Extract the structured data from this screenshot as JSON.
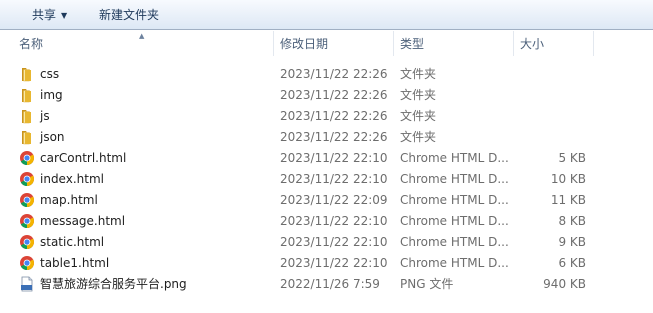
{
  "toolbar": {
    "share_label": "共享",
    "share_arrow": "▼",
    "newfolder_label": "新建文件夹"
  },
  "columns": {
    "name": "名称",
    "date": "修改日期",
    "type": "类型",
    "size": "大小",
    "sort_indicator": "▲"
  },
  "colors": {
    "folder": "#e8b730",
    "chrome_red": "#db4437",
    "chrome_green": "#0f9d58",
    "chrome_yellow": "#f4b400",
    "chrome_blue": "#4285f4",
    "png_blue": "#3b6fb6"
  },
  "files": [
    {
      "name": "css",
      "date": "2023/11/22 22:26",
      "type": "文件夹",
      "size": "",
      "icon": "folder-icon"
    },
    {
      "name": "img",
      "date": "2023/11/22 22:26",
      "type": "文件夹",
      "size": "",
      "icon": "folder-icon"
    },
    {
      "name": "js",
      "date": "2023/11/22 22:26",
      "type": "文件夹",
      "size": "",
      "icon": "folder-icon"
    },
    {
      "name": "json",
      "date": "2023/11/22 22:26",
      "type": "文件夹",
      "size": "",
      "icon": "folder-icon"
    },
    {
      "name": "carContrl.html",
      "date": "2023/11/22 22:10",
      "type": "Chrome HTML D...",
      "size": "5 KB",
      "icon": "chrome-icon"
    },
    {
      "name": "index.html",
      "date": "2023/11/22 22:10",
      "type": "Chrome HTML D...",
      "size": "10 KB",
      "icon": "chrome-icon"
    },
    {
      "name": "map.html",
      "date": "2023/11/22 22:09",
      "type": "Chrome HTML D...",
      "size": "11 KB",
      "icon": "chrome-icon"
    },
    {
      "name": "message.html",
      "date": "2023/11/22 22:10",
      "type": "Chrome HTML D...",
      "size": "8 KB",
      "icon": "chrome-icon"
    },
    {
      "name": "static.html",
      "date": "2023/11/22 22:10",
      "type": "Chrome HTML D...",
      "size": "9 KB",
      "icon": "chrome-icon"
    },
    {
      "name": "table1.html",
      "date": "2023/11/22 22:10",
      "type": "Chrome HTML D...",
      "size": "6 KB",
      "icon": "chrome-icon"
    },
    {
      "name": "智慧旅游综合服务平台.png",
      "date": "2022/11/26 7:59",
      "type": "PNG 文件",
      "size": "940 KB",
      "icon": "png-file-icon"
    }
  ]
}
